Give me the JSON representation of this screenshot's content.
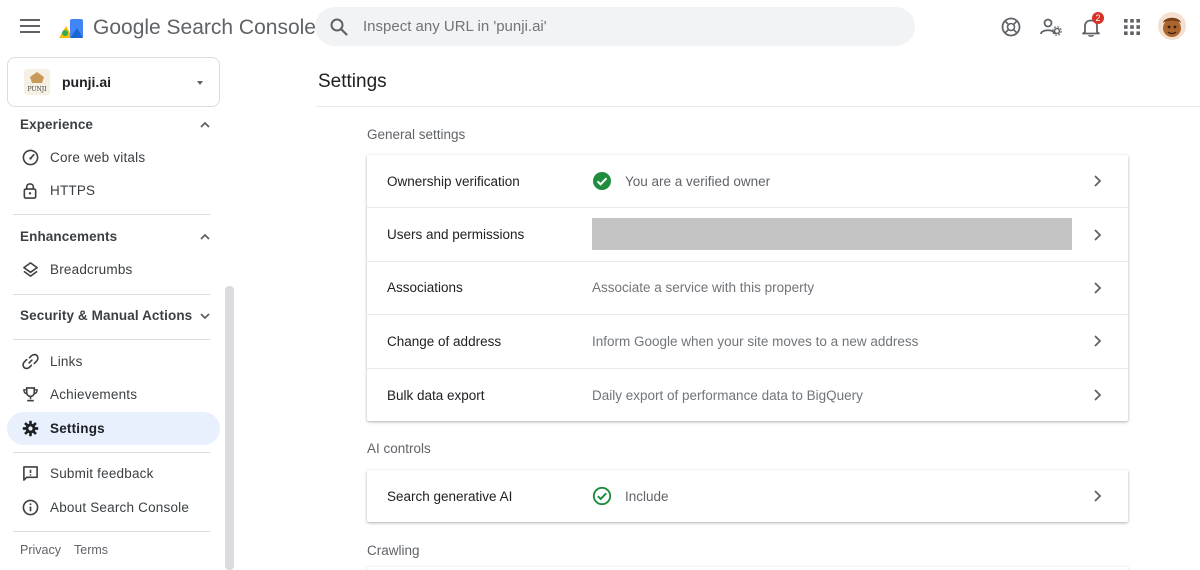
{
  "app": {
    "title": "Google Search Console"
  },
  "search": {
    "placeholder": "Inspect any URL in 'punji.ai'",
    "value": ""
  },
  "notifications": {
    "count": "2"
  },
  "property": {
    "name": "punji.ai",
    "logo_text": "PUNJI"
  },
  "sidebar": {
    "experience": {
      "header": "Experience",
      "items": [
        "Core web vitals",
        "HTTPS"
      ]
    },
    "enhancements": {
      "header": "Enhancements",
      "items": [
        "Breadcrumbs"
      ]
    },
    "security": {
      "header": "Security & Manual Actions"
    },
    "items": [
      "Links",
      "Achievements",
      "Settings"
    ],
    "active": "Settings",
    "bottom_items": [
      "Submit feedback",
      "About Search Console"
    ],
    "footer": [
      "Privacy",
      "Terms"
    ]
  },
  "main": {
    "title": "Settings",
    "general": {
      "label": "General settings",
      "rows": [
        {
          "label": "Ownership verification",
          "value": "You are a verified owner",
          "status": "verified"
        },
        {
          "label": "Users and permissions",
          "value": "",
          "status": "redacted"
        },
        {
          "label": "Associations",
          "value": "Associate a service with this property"
        },
        {
          "label": "Change of address",
          "value": "Inform Google when your site moves to a new address"
        },
        {
          "label": "Bulk data export",
          "value": "Daily export of performance data to BigQuery"
        }
      ]
    },
    "ai": {
      "label": "AI controls",
      "rows": [
        {
          "label": "Search generative AI",
          "value": "Include",
          "status": "verified"
        }
      ]
    },
    "crawling": {
      "label": "Crawling"
    }
  },
  "colors": {
    "accent": "#1a73e8",
    "active_bg": "#e8f0fe",
    "success": "#1e8e3e",
    "icon": "#5f6368",
    "badge": "#d93025"
  },
  "icons": {
    "menu": "menu-icon",
    "search": "search-icon",
    "help": "help-icon",
    "manage_accounts": "manage-accounts-icon",
    "notifications": "bell-icon",
    "apps": "apps-grid-icon"
  }
}
